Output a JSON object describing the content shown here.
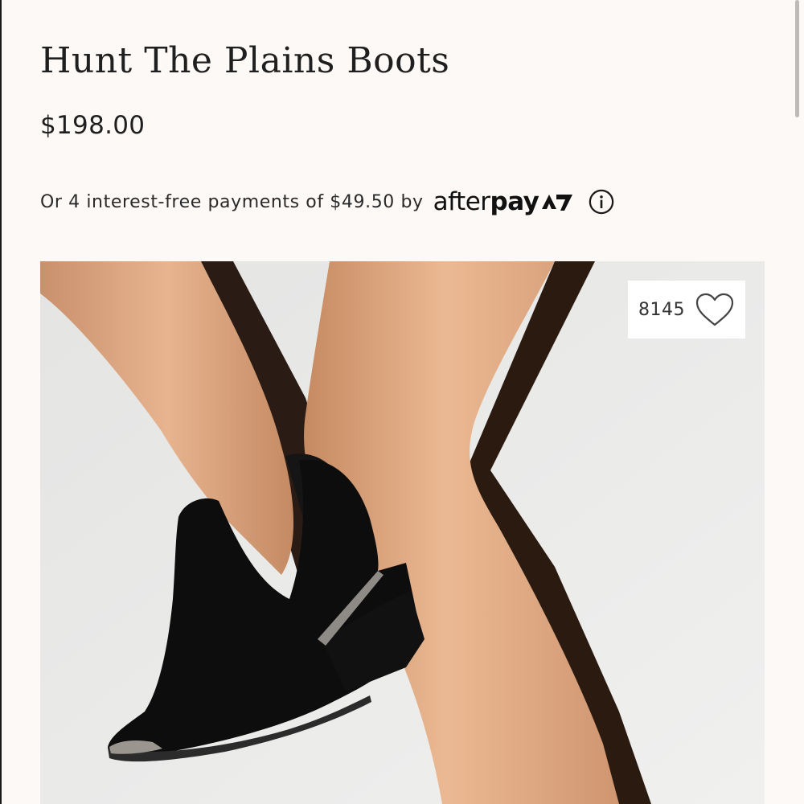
{
  "product": {
    "title": "Hunt The Plains Boots",
    "price": "$198.00"
  },
  "afterpay": {
    "text": "Or 4 interest-free payments of $49.50 by",
    "logo_light": "after",
    "logo_bold": "pay",
    "logo_icon": "afterpay-arrows-icon",
    "info_icon": "info-icon"
  },
  "image": {
    "subject": "black suede ankle boots with metal toe cap",
    "favorite": {
      "count": "8145",
      "icon": "heart-outline-icon"
    }
  },
  "colors": {
    "page_background": "#fdf9f6",
    "text": "#1f1f1f",
    "boot": "#0d0d0d",
    "image_background": "#ebebea"
  }
}
